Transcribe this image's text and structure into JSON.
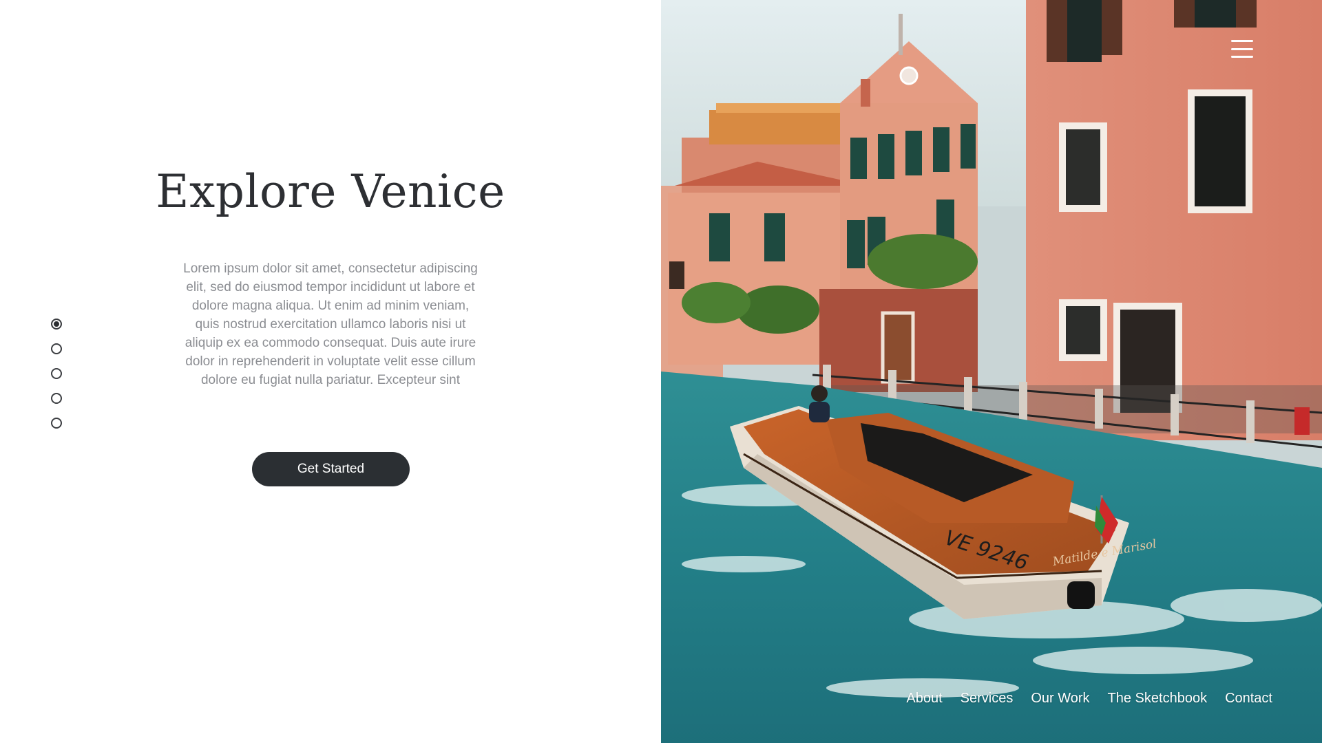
{
  "hero": {
    "title": "Explore Venice",
    "lead": "Lorem ipsum dolor sit amet, consectetur adipiscing elit, sed do eiusmod tempor incididunt ut labore et dolore magna aliqua. Ut enim ad minim veniam, quis nostrud exercitation ullamco laboris nisi ut aliquip ex ea commodo consequat. Duis aute irure dolor in reprehenderit in voluptate velit esse cillum dolore eu fugiat nulla pariatur. Excepteur sint",
    "cta_label": "Get Started"
  },
  "pager": {
    "count": 5,
    "active_index": 0
  },
  "menu": {
    "icon": "hamburger-menu-icon"
  },
  "nav": {
    "items": [
      {
        "label": "About"
      },
      {
        "label": "Services"
      },
      {
        "label": "Our Work"
      },
      {
        "label": "The Sketchbook"
      },
      {
        "label": "Contact"
      }
    ]
  },
  "photo": {
    "boat_registration": "VE 9246",
    "boat_name": "Matilde e Marisol"
  },
  "colors": {
    "title": "#2d2f33",
    "body_text": "#8b8d92",
    "button": "#2b2f33",
    "water": "#2a8c93",
    "building": "#d98a6f"
  }
}
